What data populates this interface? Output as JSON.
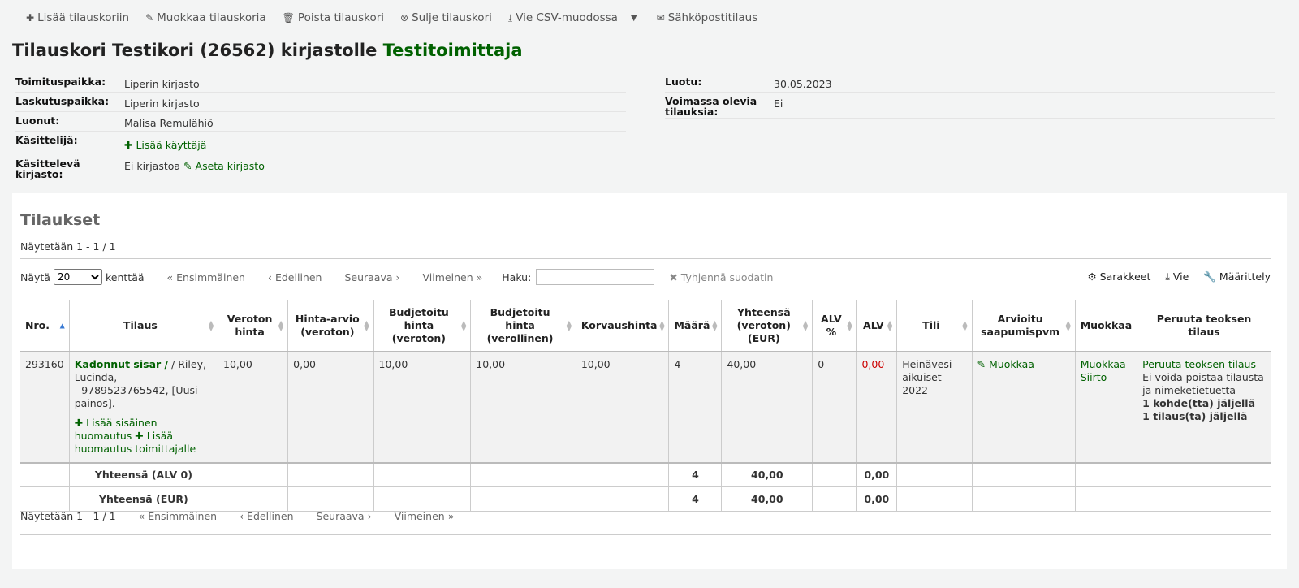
{
  "toolbar": {
    "add": "Lisää tilauskoriin",
    "edit": "Muokkaa tilauskoria",
    "delete": "Poista tilauskori",
    "close": "Sulje tilauskori",
    "export": "Vie CSV-muodossa",
    "email": "Sähköpostitilaus"
  },
  "header": {
    "title": "Tilauskori Testikori (26562) kirjastolle",
    "vendor": "Testitoimittaja"
  },
  "info_left": [
    {
      "label": "Toimituspaikka:",
      "value": "Liperin kirjasto"
    },
    {
      "label": "Laskutuspaikka:",
      "value": "Liperin kirjasto"
    },
    {
      "label": "Luonut:",
      "value": "Malisa Remulähiö"
    },
    {
      "label": "Käsittelijä:",
      "link": "Lisää käyttäjä"
    },
    {
      "label": "Käsittelevä kirjasto:",
      "value": "Ei kirjastoa",
      "link": "Aseta kirjasto"
    }
  ],
  "info_right": [
    {
      "label": "Luotu:",
      "value": "30.05.2023"
    },
    {
      "label": "Voimassa olevia tilauksia:",
      "value": "Ei"
    }
  ],
  "orders": {
    "title": "Tilaukset",
    "showing": "Näytetään 1 - 1 / 1",
    "show_label": "Näytä",
    "page_size": "20",
    "entries_label": "kenttää",
    "first": "Ensimmäinen",
    "prev": "Edellinen",
    "next": "Seuraava",
    "last": "Viimeinen",
    "search_label": "Haku:",
    "search_value": "",
    "clear_filter": "Tyhjennä suodatin",
    "columns_btn": "Sarakkeet",
    "export_btn": "Vie",
    "configure_btn": "Määrittely"
  },
  "table": {
    "headers": [
      "Nro.",
      "Tilaus",
      "Veroton hinta",
      "Hinta-arvio (veroton)",
      "Budjetoitu hinta (veroton)",
      "Budjetoitu hinta (verollinen)",
      "Korvaushinta",
      "Määrä",
      "Yhteensä (veroton) (EUR)",
      "ALV %",
      "ALV",
      "Tili",
      "Arvioitu saapumispvm",
      "Muokkaa",
      "Peruuta teoksen tilaus"
    ],
    "row": {
      "nro": "293160",
      "title": "Kadonnut sisar /",
      "author": " / Riley, Lucinda,",
      "isbn": "- 9789523765542, [Uusi painos].",
      "add_internal_note": "Lisää sisäinen huomautus",
      "add_vendor_note": "Lisää huomautus toimittajalle",
      "price": "10,00",
      "estimate": "0,00",
      "budget_excl": "10,00",
      "budget_incl": "10,00",
      "replacement": "10,00",
      "quantity": "4",
      "total": "40,00",
      "vat_rate": "0",
      "vat": "0,00",
      "fund": "Heinävesi aikuiset 2022",
      "eta_edit": "Muokkaa",
      "edit": "Muokkaa",
      "transfer": "Siirto",
      "cancel": "Peruuta teoksen tilaus",
      "cannot_delete": "Ei voida poistaa tilausta ja nimeketietuetta",
      "items_left": "1 kohde(tta) jäljellä",
      "orders_left": "1 tilaus(ta) jäljellä"
    },
    "footer": [
      {
        "label": "Yhteensä (ALV 0)",
        "qty": "4",
        "total": "40,00",
        "vat": "0,00"
      },
      {
        "label": "Yhteensä (EUR)",
        "qty": "4",
        "total": "40,00",
        "vat": "0,00"
      }
    ]
  },
  "colors": {
    "green": "#006100",
    "red": "#cc0000"
  }
}
